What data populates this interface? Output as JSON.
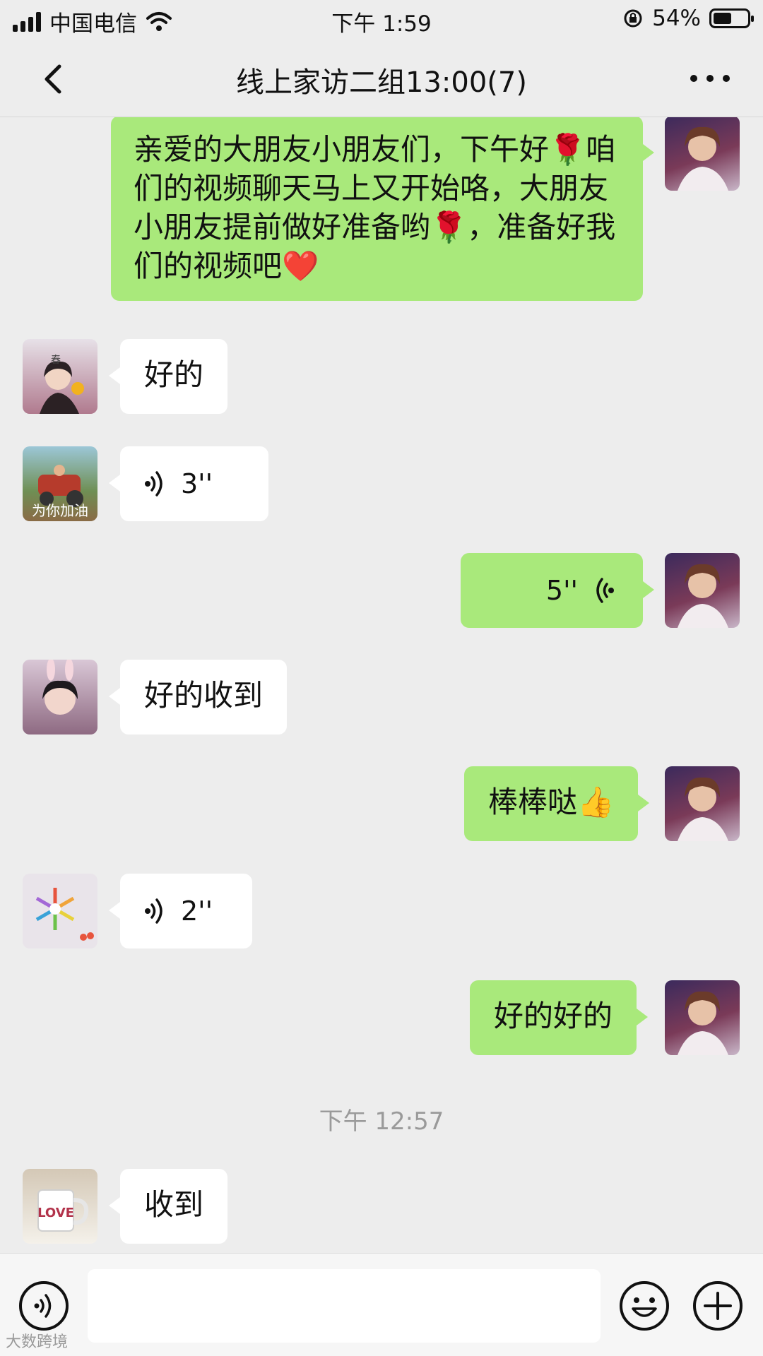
{
  "status_bar": {
    "carrier": "中国电信",
    "time": "下午 1:59",
    "battery": "54%",
    "battery_level": 0.54
  },
  "header": {
    "title": "线上家访二组13:00(7)"
  },
  "messages": [
    {
      "side": "me",
      "type": "text",
      "text": "亲爱的大朋友小朋友们，下午好🌹咱们的视频聊天马上又开始咯，大朋友小朋友提前做好准备哟🌹，准备好我们的视频吧❤️"
    },
    {
      "side": "other",
      "type": "text",
      "text": "好的",
      "avatar_caption": "春"
    },
    {
      "side": "other",
      "type": "voice",
      "duration": "3''",
      "avatar_caption": "为你加油"
    },
    {
      "side": "me",
      "type": "voice",
      "duration": "5''"
    },
    {
      "side": "other",
      "type": "text",
      "text": "好的收到"
    },
    {
      "side": "me",
      "type": "text",
      "text": "棒棒哒👍"
    },
    {
      "side": "other",
      "type": "voice",
      "duration": "2''"
    },
    {
      "side": "me",
      "type": "text",
      "text": "好的好的"
    },
    {
      "side": "other",
      "type": "text",
      "text": "收到",
      "avatar_caption": "LOVE"
    }
  ],
  "timestamp": "下午 12:57",
  "watermark": "大数跨境",
  "icons": {
    "back": "chevron-left-icon",
    "more": "more-dots-icon",
    "voice_input": "voice-input-icon",
    "emoji": "emoji-icon",
    "plus": "plus-icon"
  },
  "colors": {
    "background": "#ededed",
    "my_bubble": "#a9e97b",
    "other_bubble": "#ffffff"
  }
}
